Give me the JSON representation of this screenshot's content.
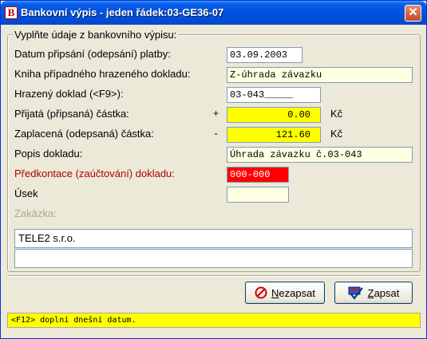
{
  "window": {
    "title": "Bankovní výpis - jeden řádek:03-GE36-07",
    "close_label": "✕",
    "icon_letter": "B"
  },
  "form": {
    "legend": "Vyplňte údaje z bankovního výpisu:",
    "fields": [
      {
        "label": "Datum připsání (odepsání) platby:",
        "value": "03.09.2003"
      },
      {
        "label": "Kniha případného hrazeného dokladu:",
        "value": "Z-úhrada závazku"
      },
      {
        "label": "Hrazený doklad (<F9>):",
        "value": "03-043_____"
      },
      {
        "label": "Přijatá (připsaná) částka:",
        "sign": "+",
        "value": "0.00",
        "unit": "Kč"
      },
      {
        "label": "Zaplacená (odepsaná) částka:",
        "sign": "-",
        "value": "121.60",
        "unit": "Kč"
      },
      {
        "label": "Popis dokladu:",
        "value": "Úhrada závazku č.03-043"
      },
      {
        "label": "Předkontace (zaúčtování) dokladu:",
        "value": "000-000"
      },
      {
        "label": "Úsek",
        "value": ""
      },
      {
        "label": "Zakázka:"
      }
    ],
    "partner_name": "TELE2 s.r.o.",
    "partner_extra": ""
  },
  "buttons": {
    "cancel": {
      "mnemonic": "N",
      "rest": "ezapsat"
    },
    "save": {
      "mnemonic": "Z",
      "rest": "apsat"
    }
  },
  "status_text": "<F12> doplní dnešní datum.",
  "colors": {
    "accent_yellow": "#ffff00",
    "alert_red": "#ff0000",
    "field_cream": "#ffffe1"
  }
}
